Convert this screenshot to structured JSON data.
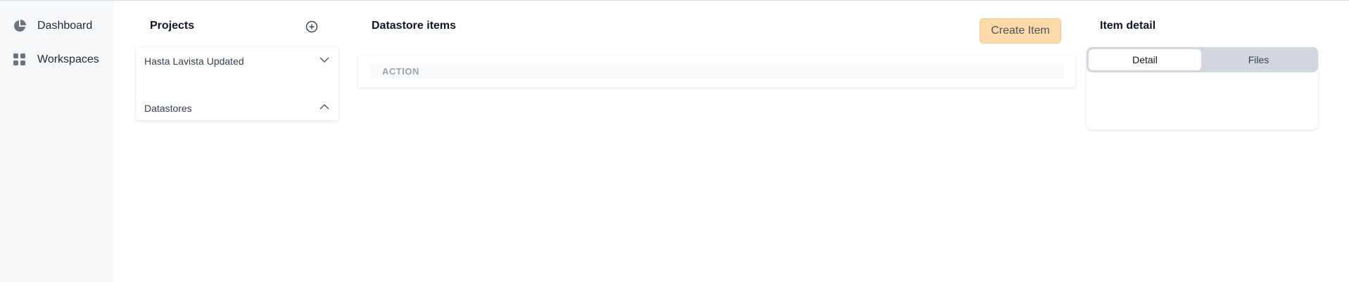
{
  "sidebar": {
    "items": [
      {
        "label": "Dashboard",
        "icon": "pie-chart-icon"
      },
      {
        "label": "Workspaces",
        "icon": "grid-icon"
      }
    ]
  },
  "projects": {
    "title": "Projects",
    "add_icon": "add-circle-icon",
    "rows": [
      {
        "label": "Hasta Lavista Updated",
        "icon": "chevron-down-icon"
      },
      {
        "label": "Datastores",
        "icon": "chevron-up-icon"
      }
    ]
  },
  "datastore": {
    "title": "Datastore items",
    "create_label": "Create Item",
    "columns": [
      "ACTION"
    ]
  },
  "item_detail": {
    "title": "Item detail",
    "tabs": [
      {
        "label": "Detail",
        "active": true
      },
      {
        "label": "Files",
        "active": false
      }
    ]
  },
  "colors": {
    "create_button": "#fcd9a8",
    "tabs_background": "#d1d6e2",
    "sidebar_background": "#f7f8fa"
  }
}
